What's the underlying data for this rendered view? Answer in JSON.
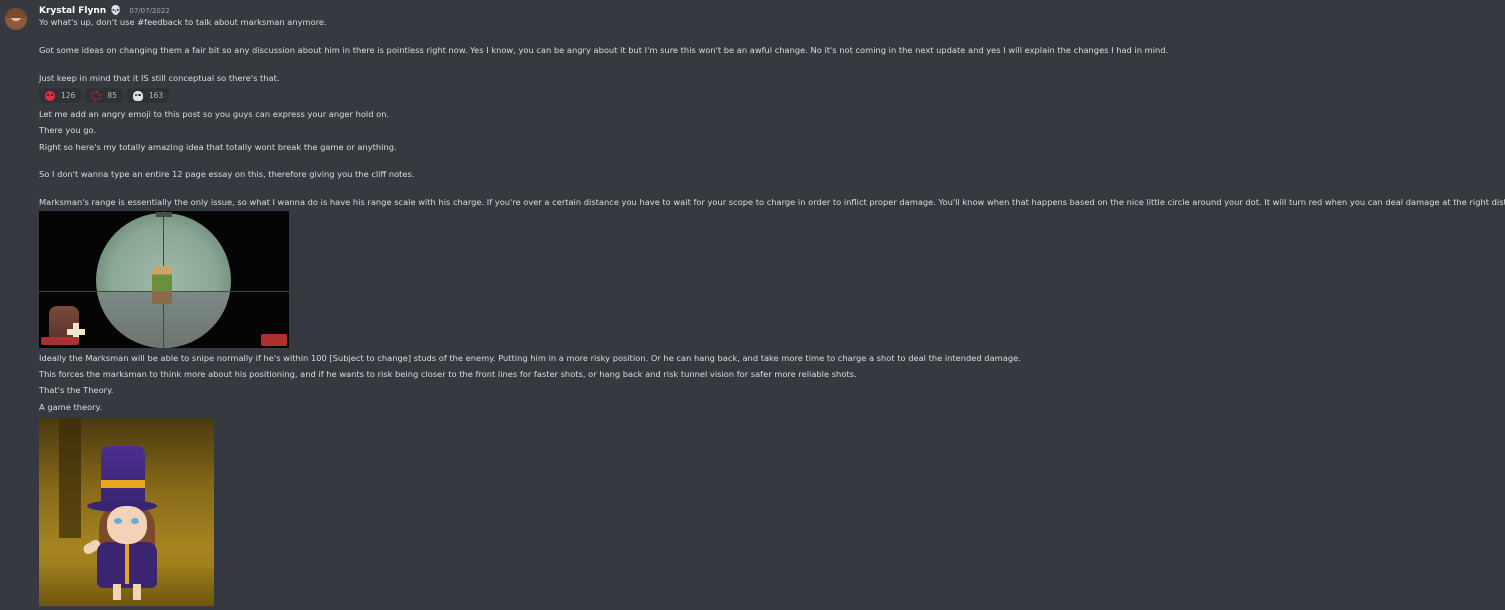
{
  "message": {
    "author": {
      "username": "Krystal Flynn",
      "badge_icon": "skull-icon",
      "badge_glyph": "💀",
      "avatar_icon": "avatar-icon"
    },
    "timestamp": "07/07/2022",
    "lines_group_1": [
      "Yo what's up, don't use #feedback to talk about marksman anymore.",
      "Got some ideas on changing them a fair bit so any discussion about him in there is pointless right now. Yes I know, you can be angry about it but I'm sure this won't be an awful change. No it's not coming in the next update and yes I will explain the changes I had in mind.",
      "Just keep in mind that it IS still conceptual so there's that."
    ],
    "reactions": [
      {
        "emoji": "angry-face-icon",
        "count": "126",
        "color": "#dd2e44"
      },
      {
        "emoji": "anger-puff-icon",
        "count": "85",
        "color": "#c4202f"
      },
      {
        "emoji": "skull-icon",
        "count": "163",
        "color": "#e1e1e1"
      }
    ],
    "lines_group_2": [
      "Let me add an angry emoji to this post so you guys can express your anger hold on.",
      "There you go.",
      "Right so here's my totally amazing idea that totally wont break the game or anything.",
      "So I don't wanna type an entire 12 page essay on this, therefore giving you the cliff notes.",
      "Marksman's range is essentially the only issue, so what I wanna do is have his range scale with his charge. If you're over a certain distance you have to wait for your scope to charge in order to inflict proper damage. You'll know when that happens based on the nice little circle around your dot. It will turn red when you can deal damage at the right distance."
    ],
    "lines_group_3": [
      "Ideally the Marksman will be able to snipe normally if he's within 100 [Subject to change] studs of the enemy. Putting him in a more risky position. Or he can hang back, and take more time to charge a shot to deal the intended damage.",
      "This forces the marksman to think more about his positioning, and if he wants to risk being closer to the front lines for faster shots, or hang back and risk tunnel vision for safer more reliable shots.",
      "That's the Theory.",
      "A game theory."
    ],
    "attachments": [
      {
        "kind": "image",
        "name": "sniper-scope-screenshot"
      },
      {
        "kind": "gif",
        "name": "hat-kid-gif"
      }
    ]
  },
  "colors": {
    "background": "#36393f",
    "text": "#dcddde",
    "username": "#ffffff",
    "timestamp": "#a3a6aa",
    "reaction_bg": "#2f3136"
  }
}
